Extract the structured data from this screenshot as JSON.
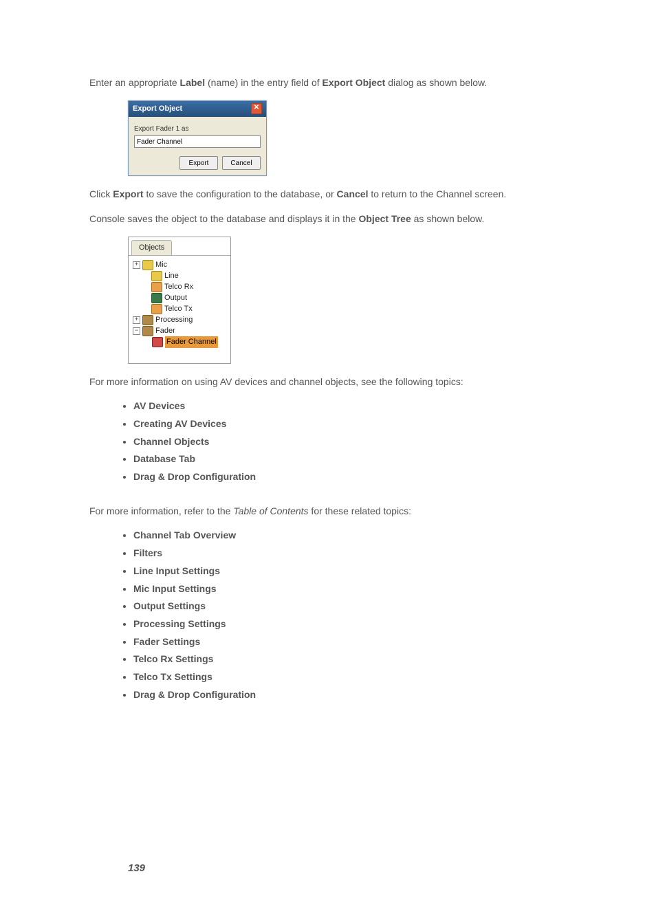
{
  "para1": {
    "t1": "Enter an appropriate ",
    "b1": "Label",
    "t2": " (name) in the entry field of ",
    "b2": "Export Object",
    "t3": " dialog as shown below."
  },
  "dialog": {
    "title": "Export Object",
    "close": "✕",
    "label": "Export Fader 1 as",
    "value": "Fader Channel",
    "export": "Export",
    "cancel": "Cancel"
  },
  "para2": {
    "t1": "Click ",
    "b1": "Export",
    "t2": " to save the configuration to the database, or ",
    "b2": "Cancel",
    "t3": " to return to the Channel screen."
  },
  "para3": {
    "t1": "Console saves the object to the database and displays it in the ",
    "b1": "Object Tree",
    "t2": " as shown below."
  },
  "tree": {
    "tab": "Objects",
    "plus": "+",
    "minus": "−",
    "items": {
      "mic": "Mic",
      "line": "Line",
      "telcoRx": "Telco Rx",
      "output": "Output",
      "telcoTx": "Telco Tx",
      "processing": "Processing",
      "fader": "Fader",
      "faderChannel": "Fader Channel"
    }
  },
  "para4": "For more information on using AV devices and channel objects, see the following topics:",
  "listA": {
    "i0": "AV Devices",
    "i1": "Creating AV Devices",
    "i2": "Channel Objects",
    "i3": "Database Tab",
    "i4": "Drag & Drop Configuration"
  },
  "para5": {
    "t1": "For more information, refer to the ",
    "i1": "Table of Contents",
    "t2": " for these related topics:"
  },
  "listB": {
    "i0": "Channel Tab Overview",
    "i1": "Filters",
    "i2": "Line Input Settings",
    "i3": "Mic Input Settings",
    "i4": "Output Settings",
    "i5": "Processing Settings",
    "i6": "Fader Settings",
    "i7": "Telco Rx Settings",
    "i8": "Telco Tx Settings",
    "i9": "Drag & Drop Configuration"
  },
  "pageNumber": "139"
}
